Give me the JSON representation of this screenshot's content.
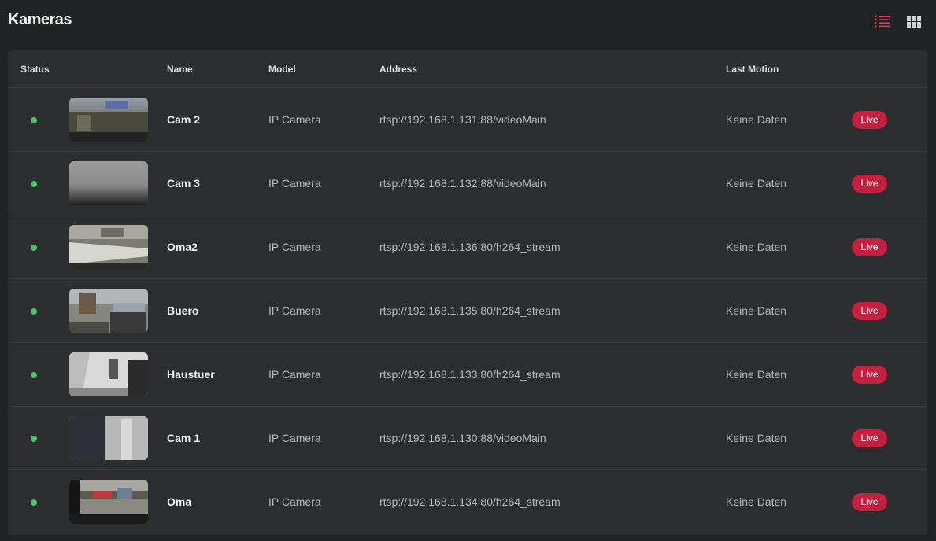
{
  "header": {
    "title": "Kameras",
    "list_view_icon": "list-icon",
    "grid_view_icon": "grid-icon",
    "accent_color": "#e8375e"
  },
  "table": {
    "columns": {
      "status": "Status",
      "name": "Name",
      "model": "Model",
      "address": "Address",
      "last_motion": "Last Motion"
    },
    "rows": [
      {
        "status": "online",
        "name": "Cam 2",
        "model": "IP Camera",
        "address": "rtsp://192.168.1.131:88/videoMain",
        "last_motion": "Keine Daten",
        "action": "Live"
      },
      {
        "status": "online",
        "name": "Cam 3",
        "model": "IP Camera",
        "address": "rtsp://192.168.1.132:88/videoMain",
        "last_motion": "Keine Daten",
        "action": "Live"
      },
      {
        "status": "online",
        "name": "Oma2",
        "model": "IP Camera",
        "address": "rtsp://192.168.1.136:80/h264_stream",
        "last_motion": "Keine Daten",
        "action": "Live"
      },
      {
        "status": "online",
        "name": "Buero",
        "model": "IP Camera",
        "address": "rtsp://192.168.1.135:80/h264_stream",
        "last_motion": "Keine Daten",
        "action": "Live"
      },
      {
        "status": "online",
        "name": "Haustuer",
        "model": "IP Camera",
        "address": "rtsp://192.168.1.133:80/h264_stream",
        "last_motion": "Keine Daten",
        "action": "Live"
      },
      {
        "status": "online",
        "name": "Cam 1",
        "model": "IP Camera",
        "address": "rtsp://192.168.1.130:88/videoMain",
        "last_motion": "Keine Daten",
        "action": "Live"
      },
      {
        "status": "online",
        "name": "Oma",
        "model": "IP Camera",
        "address": "rtsp://192.168.1.134:80/h264_stream",
        "last_motion": "Keine Daten",
        "action": "Live"
      }
    ]
  },
  "colors": {
    "status_online": "#4fc36b",
    "live_badge": "#c4203f"
  }
}
